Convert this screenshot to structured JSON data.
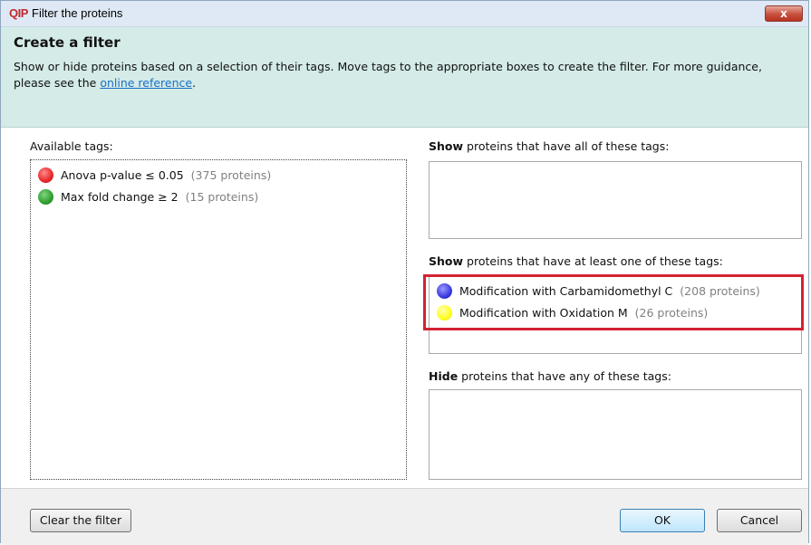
{
  "window": {
    "logo": "QIP",
    "title": "Filter the proteins",
    "close_label": "x"
  },
  "header": {
    "title": "Create a filter",
    "description": "Show or hide proteins based on a selection of their tags. Move tags to the appropriate boxes to create the filter. For more guidance, please see the",
    "link_text": "online reference",
    "suffix": "."
  },
  "available": {
    "label": "Available tags:",
    "tags": [
      {
        "name": "Anova p-value ≤ 0.05",
        "count": "(375 proteins)",
        "color": "#e8272a"
      },
      {
        "name": "Max fold change ≥ 2",
        "count": "(15 proteins)",
        "color": "#2f9e2f"
      }
    ]
  },
  "show_all": {
    "label_bold": "Show",
    "label_rest": "proteins that have all of these tags:"
  },
  "show_any": {
    "label_bold": "Show",
    "label_rest": "proteins that have at least one of these tags:",
    "tags": [
      {
        "name": "Modification with Carbamidomethyl C",
        "count": "(208 proteins)",
        "color": "#3a3ae0"
      },
      {
        "name": "Modification with Oxidation M",
        "count": "(26 proteins)",
        "color": "#ffff20"
      }
    ]
  },
  "hide": {
    "label_bold": "Hide",
    "label_rest": "proteins that have any of these tags:"
  },
  "footer": {
    "clear_label": "Clear the filter",
    "ok_label": "OK",
    "cancel_label": "Cancel"
  },
  "colors": {
    "highlight": "#d42232",
    "header_bg": "#d4ebe8",
    "link": "#1a6fc4"
  }
}
